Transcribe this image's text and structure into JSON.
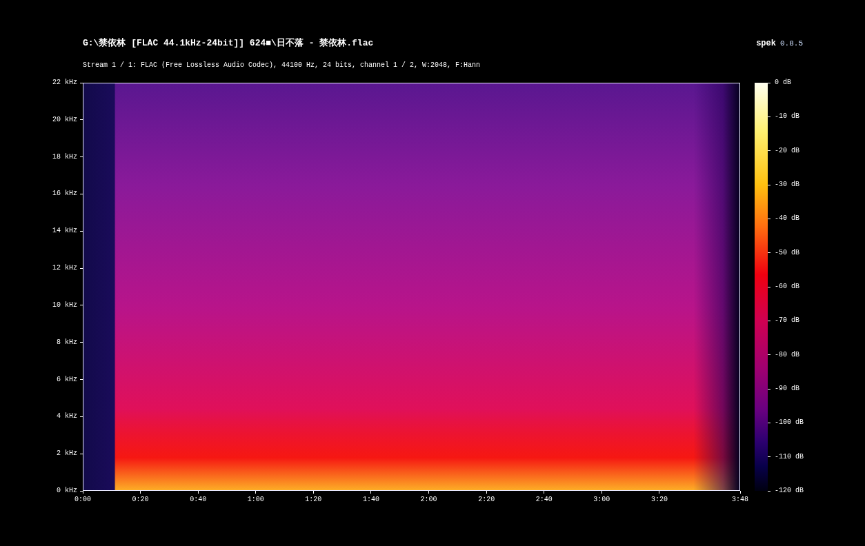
{
  "header": {
    "title": "G:\\禁依林 [FLAC 44.1kHz-24bit]] 624■\\日不落 - 禁依林.flac",
    "subtitle": "Stream 1 / 1: FLAC (Free Lossless Audio Codec), 44100 Hz, 24 bits, channel 1 / 2, W:2048, F:Hann",
    "app_name": "spek",
    "version": "0.8.5"
  },
  "frequency_axis": [
    "22 kHz",
    "20 kHz",
    "18 kHz",
    "16 kHz",
    "14 kHz",
    "12 kHz",
    "10 kHz",
    "8 kHz",
    "6 kHz",
    "4 kHz",
    "2 kHz",
    "0 kHz"
  ],
  "time_axis": [
    "0:00",
    "0:20",
    "0:40",
    "1:00",
    "1:20",
    "1:40",
    "2:00",
    "2:20",
    "2:40",
    "3:00",
    "3:20",
    "3:48"
  ],
  "colorbar": [
    "0 dB",
    "-10 dB",
    "-20 dB",
    "-30 dB",
    "-40 dB",
    "-50 dB",
    "-60 dB",
    "-70 dB",
    "-80 dB",
    "-90 dB",
    "-100 dB",
    "-110 dB",
    "-120 dB"
  ]
}
